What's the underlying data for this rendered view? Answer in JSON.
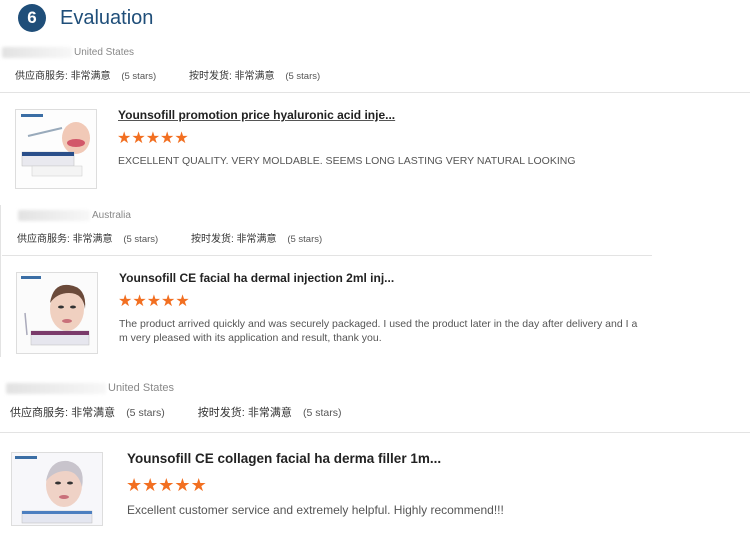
{
  "section": {
    "number": "6",
    "title": "Evaluation"
  },
  "reviews": [
    {
      "country": "United States",
      "supplier_label": "供应商服务:",
      "supplier_value": "非常满意",
      "supplier_stars": "(5 stars)",
      "delivery_label": "按时发货:",
      "delivery_value": "非常满意",
      "delivery_stars": "(5 stars)",
      "product_title": "Younsofill promotion price hyaluronic acid inje...",
      "rating": 5,
      "comment": "EXCELLENT QUALITY. VERY MOLDABLE. SEEMS LONG LASTING VERY NATURAL LOOKING"
    },
    {
      "country": "Australia",
      "supplier_label": "供应商服务:",
      "supplier_value": "非常满意",
      "supplier_stars": "(5 stars)",
      "delivery_label": "按时发货:",
      "delivery_value": "非常满意",
      "delivery_stars": "(5 stars)",
      "product_title": "Younsofill CE facial ha dermal injection 2ml inj...",
      "rating": 5,
      "comment": "The product arrived quickly and was securely packaged. I used the product later in the day after delivery and I am very pleased with its application and result, thank you."
    },
    {
      "country": "United States",
      "supplier_label": "供应商服务:",
      "supplier_value": "非常满意",
      "supplier_stars": "(5 stars)",
      "delivery_label": "按时发货:",
      "delivery_value": "非常满意",
      "delivery_stars": "(5 stars)",
      "product_title": "Younsofill CE collagen facial ha derma filler 1m...",
      "rating": 5,
      "comment": "Excellent customer service and extremely helpful. Highly recommend!!!"
    }
  ],
  "colors": {
    "accent": "#1f4e79",
    "star": "#f26f21"
  },
  "icons": {
    "star": "star-icon"
  }
}
